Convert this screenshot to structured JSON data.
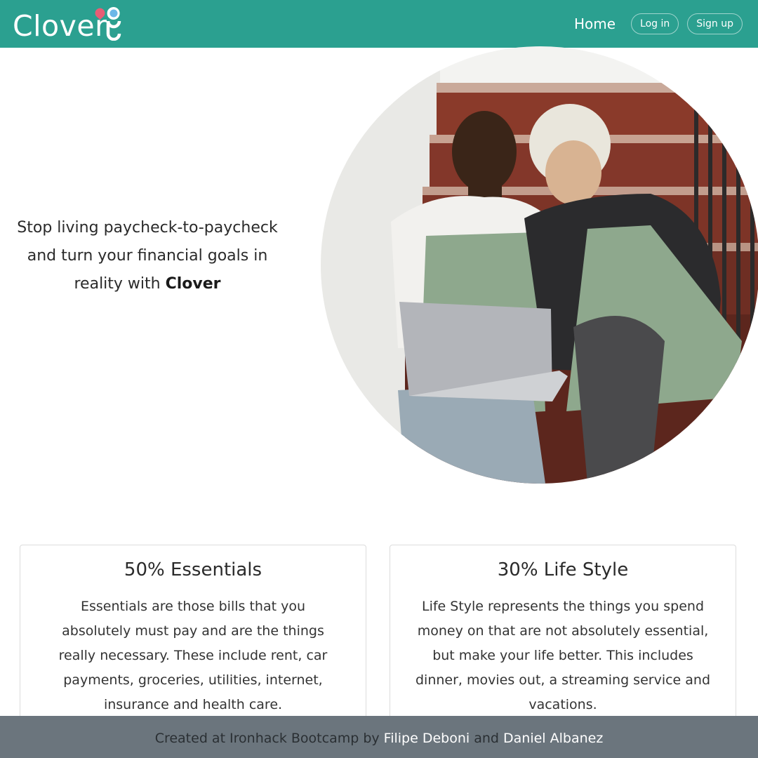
{
  "brand": {
    "name": "Clover"
  },
  "nav": {
    "home_label": "Home",
    "login_label": "Log in",
    "signup_label": "Sign up"
  },
  "hero": {
    "text_before": "Stop living paycheck-to-paycheck and turn your financial goals in reality with ",
    "text_bold": "Clover",
    "image_description": "Two people sitting on stairs looking at a laptop"
  },
  "cards": [
    {
      "title": "50% Essentials",
      "body": "Essentials are those bills that you absolutely must pay and are the things really necessary. These include rent, car payments, groceries, utilities, internet, insurance and health care."
    },
    {
      "title": "30% Life Style",
      "body": "Life Style represents the things you spend money on that are not absolutely essential, but make your life better. This includes dinner, movies out, a streaming service and vacations."
    }
  ],
  "footer": {
    "prefix": "Created at Ironhack Bootcamp by ",
    "author1": "Filipe Deboni",
    "connector": " and ",
    "author2": "Daniel Albanez"
  },
  "colors": {
    "navbar": "#2ba090",
    "footer": "#6b757d",
    "logo_dot_pink": "#e85d75",
    "logo_dot_blue": "#6cb7e8"
  }
}
